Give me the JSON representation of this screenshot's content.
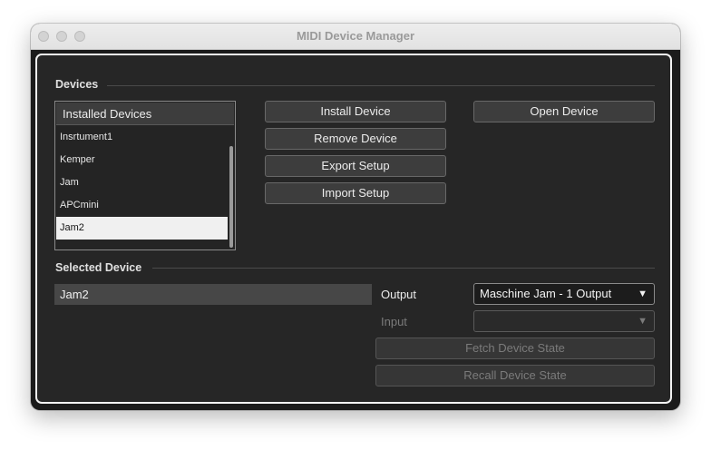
{
  "window": {
    "title": "MIDI Device Manager"
  },
  "devices": {
    "section_label": "Devices",
    "list_header": "Installed Devices",
    "items": [
      "Insrtument1",
      "Kemper",
      "Jam",
      "APCmini",
      "Jam2"
    ],
    "selected_item": "Jam2",
    "buttons": {
      "install": "Install Device",
      "remove": "Remove Device",
      "export": "Export Setup",
      "import": "Import Setup",
      "open": "Open Device"
    }
  },
  "selected_device": {
    "section_label": "Selected Device",
    "name_value": "Jam2",
    "output_label": "Output",
    "output_value": "Maschine Jam - 1 Output",
    "input_label": "Input",
    "input_value": "",
    "fetch_label": "Fetch Device State",
    "recall_label": "Recall Device State"
  },
  "icons": {
    "dropdown_arrow": "▼"
  },
  "colors": {
    "background": "#262626",
    "selected_row": "#f0f0f0",
    "button": "#3d3d3d"
  }
}
